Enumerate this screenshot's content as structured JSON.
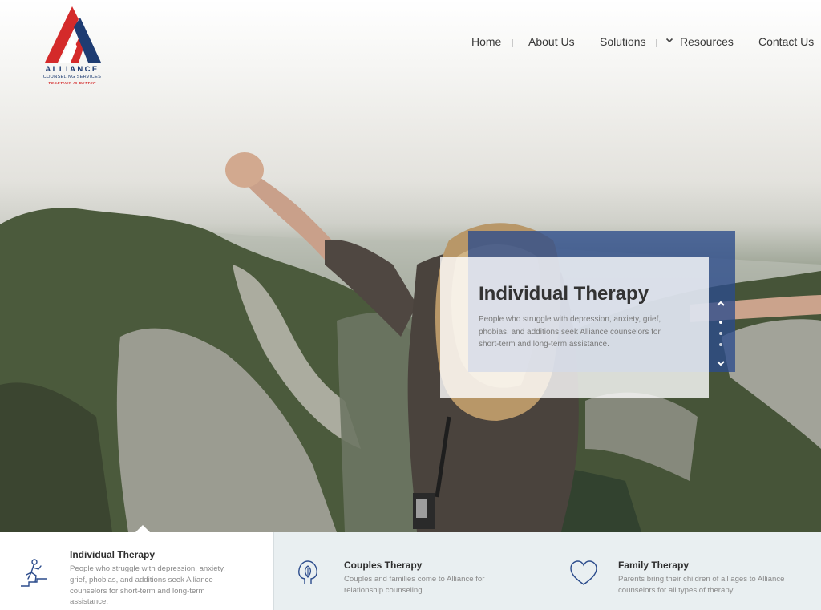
{
  "brand": {
    "name": "ALLIANCE",
    "subtitle": "COUNSELING SERVICES",
    "tagline": "TOGETHER IS BETTER",
    "colors": {
      "navy": "#1e3c72",
      "red": "#d42a2a"
    }
  },
  "nav": {
    "items": [
      {
        "label": "Home"
      },
      {
        "label": "About Us"
      },
      {
        "label": "Solutions"
      },
      {
        "label": "Resources",
        "icon": "chevron-down-icon"
      },
      {
        "label": "Contact Us"
      }
    ]
  },
  "hero": {
    "slide": {
      "title": "Individual Therapy",
      "text": "People who struggle with depression, anxiety, grief, phobias, and additions seek Alliance counselors for short-term and long-term assistance."
    },
    "slider": {
      "count": 3,
      "active_index": 0,
      "up_icon": "chevron-up-icon",
      "down_icon": "chevron-down-icon"
    },
    "colors": {
      "panel_blue": "#2c4c8c"
    }
  },
  "features": [
    {
      "title": "Individual Therapy",
      "text": "People who struggle with depression, anxiety, grief, phobias, and additions seek Alliance counselors for short-term and long-term assistance.",
      "icon": "climbing-person-icon",
      "active": true
    },
    {
      "title": "Couples Therapy",
      "text": "Couples and families come to Alliance for relationship counseling.",
      "icon": "heads-leaf-icon",
      "active": false
    },
    {
      "title": "Family Therapy",
      "text": "Parents bring their children of all ages to Alliance counselors for all types of therapy.",
      "icon": "heart-icon",
      "active": false
    }
  ]
}
